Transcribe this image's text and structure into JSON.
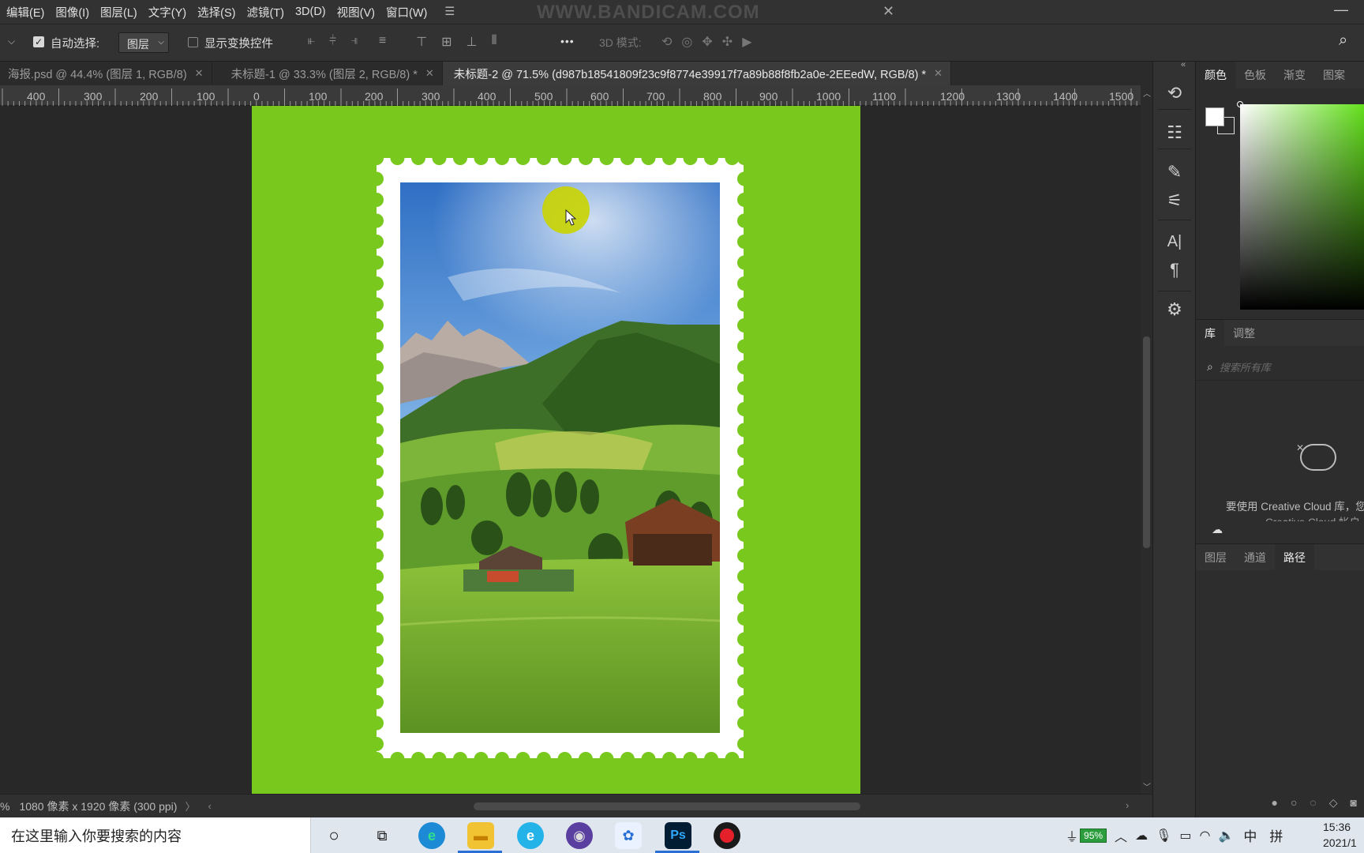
{
  "menubar": {
    "items": [
      "编辑(E)",
      "图像(I)",
      "图层(L)",
      "文字(Y)",
      "选择(S)",
      "滤镜(T)",
      "3D(D)",
      "视图(V)",
      "窗口(W)"
    ],
    "watermark": "WWW.BANDICAM.COM"
  },
  "options": {
    "auto_select_label": "自动选择:",
    "auto_select_checked": true,
    "auto_select_value": "图层",
    "show_transform_label": "显示变换控件",
    "show_transform_checked": false,
    "more": "•••",
    "mode_3d_label": "3D 模式:"
  },
  "tabs": [
    {
      "label": "海报.psd @ 44.4% (图层 1, RGB/8)",
      "active": false
    },
    {
      "label": "未标题-1 @ 33.3% (图层 2, RGB/8) *",
      "active": false
    },
    {
      "label": "未标题-2 @ 71.5% (d987b18541809f23c9f8774e39917f7a89b88f8fb2a0e-2EEedW, RGB/8) *",
      "active": true
    }
  ],
  "ruler": {
    "labels": [
      "400",
      "300",
      "200",
      "100",
      "0",
      "100",
      "200",
      "300",
      "400",
      "500",
      "600",
      "700",
      "800",
      "900",
      "1000",
      "1100",
      "1200",
      "1300",
      "1400",
      "1500"
    ]
  },
  "document": {
    "background_color": "#79c81e",
    "stamp_color": "#ffffff"
  },
  "status": {
    "zoom_fragment": "%",
    "doc_info": "1080 像素 x 1920 像素 (300 ppi)"
  },
  "right_panel": {
    "color_tabs": [
      "颜色",
      "色板",
      "渐变",
      "图案"
    ],
    "library_tabs": [
      "库",
      "调整"
    ],
    "search_placeholder": "搜索所有库",
    "cc_message_line1": "要使用 Creative Cloud 库，您",
    "cc_message_line2": "Creative Cloud 帐户",
    "layer_tabs": [
      "图层",
      "通道",
      "路径"
    ],
    "active_layer_tab": "路径"
  },
  "taskbar": {
    "search_text": "在这里输入你要搜索的内容",
    "battery": "95%",
    "ime_lang": "中",
    "ime_mode": "拼",
    "time": "15:36",
    "date": "2021/1"
  }
}
